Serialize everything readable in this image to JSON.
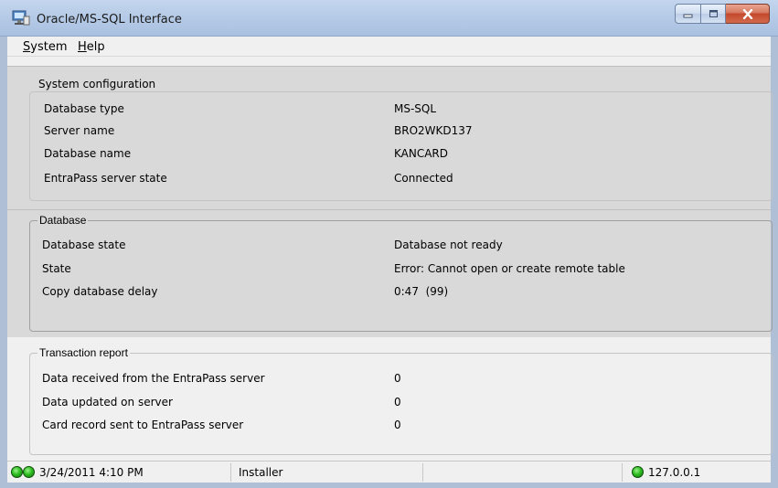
{
  "window": {
    "title": "Oracle/MS-SQL Interface"
  },
  "menu": [
    {
      "label": "System",
      "accel": "S",
      "rest": "ystem"
    },
    {
      "label": "Help",
      "accel": "H",
      "rest": "elp"
    }
  ],
  "system_configuration": {
    "title": "System configuration",
    "rows": [
      {
        "label": "Database type",
        "value": "MS-SQL"
      },
      {
        "label": "Server name",
        "value": "BRO2WKD137"
      },
      {
        "label": "Database name",
        "value": "KANCARD"
      },
      {
        "label": "EntraPass server state",
        "value": "Connected"
      }
    ]
  },
  "database": {
    "title": "Database",
    "rows": [
      {
        "label": "Database state",
        "value": "Database not ready"
      },
      {
        "label": "State",
        "value": "Error: Cannot open or create remote table"
      },
      {
        "label": "Copy database delay",
        "value": "0:47  (99)"
      }
    ]
  },
  "transaction_report": {
    "title": "Transaction report",
    "rows": [
      {
        "label": "Data received from the EntraPass server",
        "value": "0"
      },
      {
        "label": "Data updated on server",
        "value": "0"
      },
      {
        "label": "Card record sent to EntraPass server",
        "value": "0"
      }
    ]
  },
  "statusbar": {
    "datetime": "3/24/2011 4:10 PM",
    "user": "Installer",
    "ip": "127.0.0.1",
    "led_color": "#2fbf22"
  }
}
